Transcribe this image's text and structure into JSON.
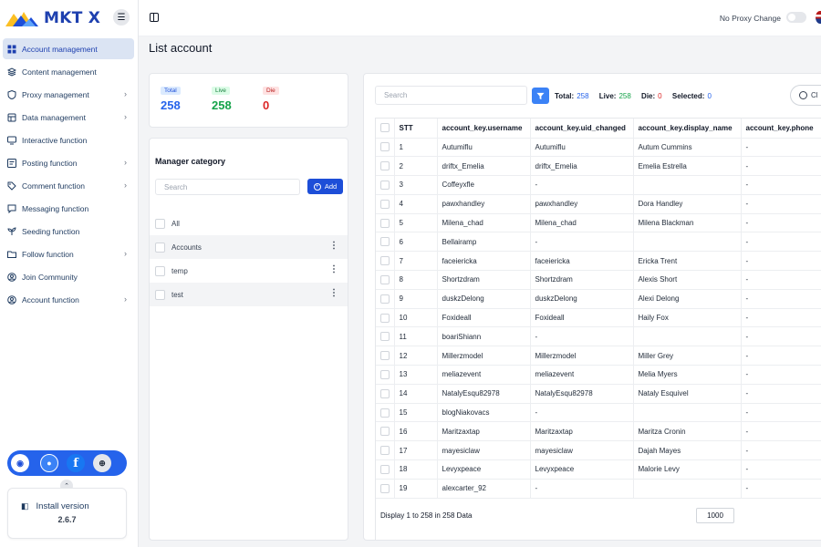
{
  "app": {
    "logo_text": "MKT X",
    "menu_toggle_icon": "hamburger-icon"
  },
  "sidebar": {
    "items": [
      {
        "label": "Account management",
        "icon": "grid-icon",
        "active": true,
        "chevron": false
      },
      {
        "label": "Content management",
        "icon": "content-icon",
        "active": false,
        "chevron": false
      },
      {
        "label": "Proxy management",
        "icon": "shield-icon",
        "active": false,
        "chevron": true
      },
      {
        "label": "Data management",
        "icon": "data-icon",
        "active": false,
        "chevron": true
      },
      {
        "label": "Interactive function",
        "icon": "monitor-icon",
        "active": false,
        "chevron": false
      },
      {
        "label": "Posting function",
        "icon": "post-icon",
        "active": false,
        "chevron": true
      },
      {
        "label": "Comment function",
        "icon": "tag-icon",
        "active": false,
        "chevron": true
      },
      {
        "label": "Messaging function",
        "icon": "chat-icon",
        "active": false,
        "chevron": false
      },
      {
        "label": "Seeding function",
        "icon": "sprout-icon",
        "active": false,
        "chevron": false
      },
      {
        "label": "Follow function",
        "icon": "folder-icon",
        "active": false,
        "chevron": true
      },
      {
        "label": "Join Community",
        "icon": "user-circle-icon",
        "active": false,
        "chevron": false
      },
      {
        "label": "Account function",
        "icon": "user-circle-icon",
        "active": false,
        "chevron": true
      }
    ],
    "install": {
      "label": "Install version",
      "version": "2.6.7"
    }
  },
  "topbar": {
    "proxy_label": "No Proxy Change"
  },
  "page": {
    "title": "List account"
  },
  "stats": {
    "total_label": "Total",
    "total_value": "258",
    "live_label": "Live",
    "live_value": "258",
    "die_label": "Die",
    "die_value": "0"
  },
  "category": {
    "title": "Manager category",
    "search_placeholder": "Search",
    "add_label": "Add",
    "items": [
      {
        "label": "All",
        "shaded": false,
        "menu": false
      },
      {
        "label": "Accounts",
        "shaded": true,
        "menu": true
      },
      {
        "label": "temp",
        "shaded": false,
        "menu": true
      },
      {
        "label": "test",
        "shaded": true,
        "menu": true
      }
    ]
  },
  "table": {
    "search_placeholder": "Search",
    "summary": {
      "total_label": "Total:",
      "total_value": "258",
      "live_label": "Live:",
      "live_value": "258",
      "die_label": "Die:",
      "die_value": "0",
      "selected_label": "Selected:",
      "selected_value": "0"
    },
    "clear_label": "Cl",
    "columns": [
      "STT",
      "account_key.username",
      "account_key.uid_changed",
      "account_key.display_name",
      "account_key.phone"
    ],
    "rows": [
      [
        "1",
        "Autumiflu",
        "Autumiflu",
        "Autum Cummins",
        "-"
      ],
      [
        "2",
        "driftx_Emelia",
        "driftx_Emelia",
        "Emelia Estrella",
        "-"
      ],
      [
        "3",
        "Coffeyxfle",
        "-",
        "",
        "-"
      ],
      [
        "4",
        "pawxhandley",
        "pawxhandley",
        "Dora Handley",
        "-"
      ],
      [
        "5",
        "Milena_chad",
        "Milena_chad",
        "Milena Blackman",
        "-"
      ],
      [
        "6",
        "Bellairamp",
        "-",
        "",
        "-"
      ],
      [
        "7",
        "faceiericka",
        "faceiericka",
        "Ericka Trent",
        "-"
      ],
      [
        "8",
        "Shortzdram",
        "Shortzdram",
        "Alexis Short",
        "-"
      ],
      [
        "9",
        "duskzDelong",
        "duskzDelong",
        "Alexi Delong",
        "-"
      ],
      [
        "10",
        "Foxideall",
        "Foxideall",
        "Haily Fox",
        "-"
      ],
      [
        "11",
        "boariShiann",
        "-",
        "",
        "-"
      ],
      [
        "12",
        "Millerzmodel",
        "Millerzmodel",
        "Miller Grey",
        "-"
      ],
      [
        "13",
        "meliazevent",
        "meliazevent",
        "Melia Myers",
        "-"
      ],
      [
        "14",
        "NatalyEsqu82978",
        "NatalyEsqu82978",
        "Nataly Esquivel",
        "-"
      ],
      [
        "15",
        "blogNiakovacs",
        "-",
        "",
        "-"
      ],
      [
        "16",
        "Maritzaxtap",
        "Maritzaxtap",
        "Maritza Cronin",
        "-"
      ],
      [
        "17",
        "mayesiclaw",
        "mayesiclaw",
        "Dajah Mayes",
        "-"
      ],
      [
        "18",
        "Levyxpeace",
        "Levyxpeace",
        "Malorie Levy",
        "-"
      ],
      [
        "19",
        "alexcarter_92",
        "-",
        "",
        "-"
      ]
    ],
    "footer": "Display 1 to 258 in 258 Data",
    "page_size": "1000"
  },
  "colors": {
    "accent": "#1d4ed8",
    "active_bg": "#dbe4f3",
    "live": "#16a34a",
    "die": "#dc2626"
  }
}
